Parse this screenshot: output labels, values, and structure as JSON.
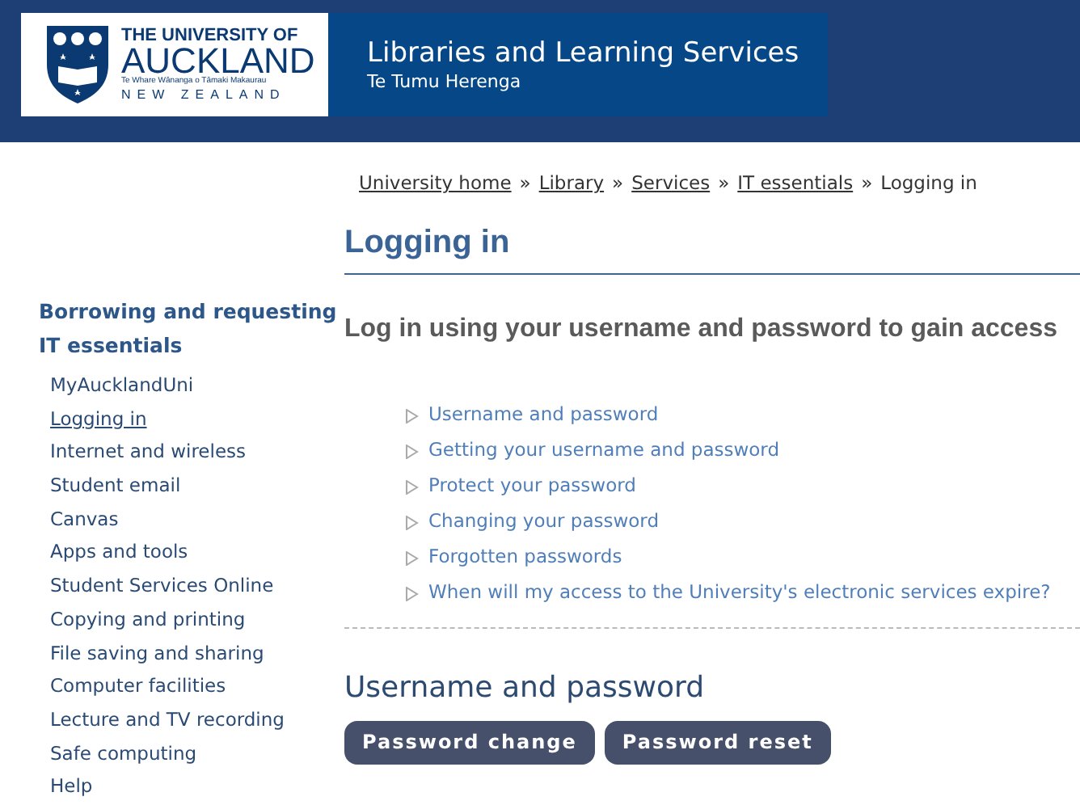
{
  "header": {
    "logo": {
      "line_1": "THE UNIVERSITY OF",
      "line_2": "AUCKLAND",
      "line_3": "Te Whare Wānanga o Tāmaki Makaurau",
      "line_4": "NEW ZEALAND"
    },
    "title": "Libraries and Learning Services",
    "subtitle": "Te Tumu Herenga"
  },
  "breadcrumb": [
    {
      "label": "University home",
      "kind": "link"
    },
    {
      "label": "»",
      "kind": "separator"
    },
    {
      "label": "Library",
      "kind": "link"
    },
    {
      "label": "»",
      "kind": "separator"
    },
    {
      "label": "Services",
      "kind": "link"
    },
    {
      "label": "»",
      "kind": "separator"
    },
    {
      "label": "IT essentials",
      "kind": "link"
    },
    {
      "label": "»",
      "kind": "separator"
    },
    {
      "label": "Logging in",
      "kind": "current"
    }
  ],
  "sidebar": {
    "sections": [
      {
        "label": "Borrowing and requesting"
      },
      {
        "label": "IT essentials",
        "children": [
          {
            "label": "MyAucklandUni",
            "selected": false
          },
          {
            "label": "Logging in",
            "selected": true
          },
          {
            "label": "Internet and wireless",
            "selected": false
          },
          {
            "label": "Student email",
            "selected": false
          },
          {
            "label": "Canvas",
            "selected": false
          },
          {
            "label": "Apps and tools",
            "selected": false
          },
          {
            "label": "Student Services Online",
            "selected": false
          },
          {
            "label": "Copying and printing",
            "selected": false
          },
          {
            "label": "File saving and sharing",
            "selected": false
          },
          {
            "label": "Computer facilities",
            "selected": false
          },
          {
            "label": "Lecture and TV recording",
            "selected": false
          },
          {
            "label": "Safe computing",
            "selected": false
          },
          {
            "label": "Help",
            "selected": false
          }
        ]
      }
    ]
  },
  "page": {
    "title": "Logging in",
    "lead": "Log in using your username and password to gain access",
    "contents": [
      "Username and password",
      "Getting your username and password",
      "Protect your password",
      "Changing your password",
      "Forgotten passwords",
      "When will my access to the University's electronic services expire?"
    ],
    "section_title": "Username and password",
    "buttons": [
      "Password change",
      "Password reset"
    ]
  }
}
